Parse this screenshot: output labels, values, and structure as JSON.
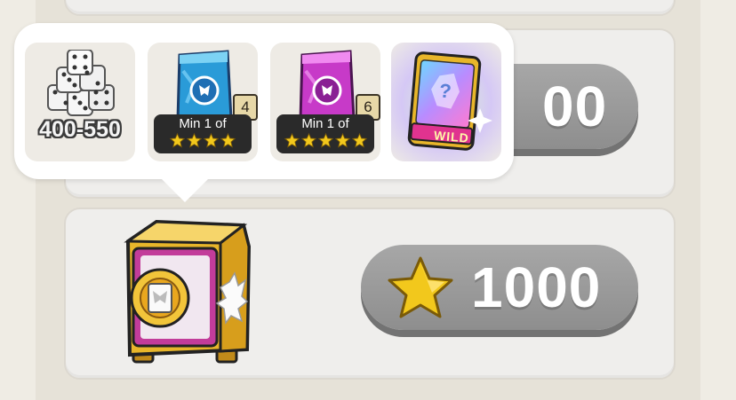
{
  "tooltip": {
    "dice": {
      "label": "400-550",
      "icon": "dice-icon"
    },
    "packs": [
      {
        "label": "Min 1 of",
        "count": "4",
        "stars": 4,
        "color": "#2a9bd8",
        "icon": "blue-sticker-pack-icon"
      },
      {
        "label": "Min 1 of",
        "count": "6",
        "stars": 5,
        "color": "#c73ac8",
        "icon": "purple-sticker-pack-icon"
      }
    ],
    "wild": {
      "label": "WILD",
      "icon": "wild-sticker-card-icon"
    }
  },
  "rows": [
    {
      "price": "00",
      "icon": "star-icon"
    },
    {
      "price": "1000",
      "icon": "star-icon",
      "reward_icon": "gold-vault-icon"
    }
  ],
  "colors": {
    "pill": "#9c9c9c",
    "star": "#f2c81c",
    "vault_gold": "#e8b62a",
    "vault_pink": "#c23c9a"
  }
}
